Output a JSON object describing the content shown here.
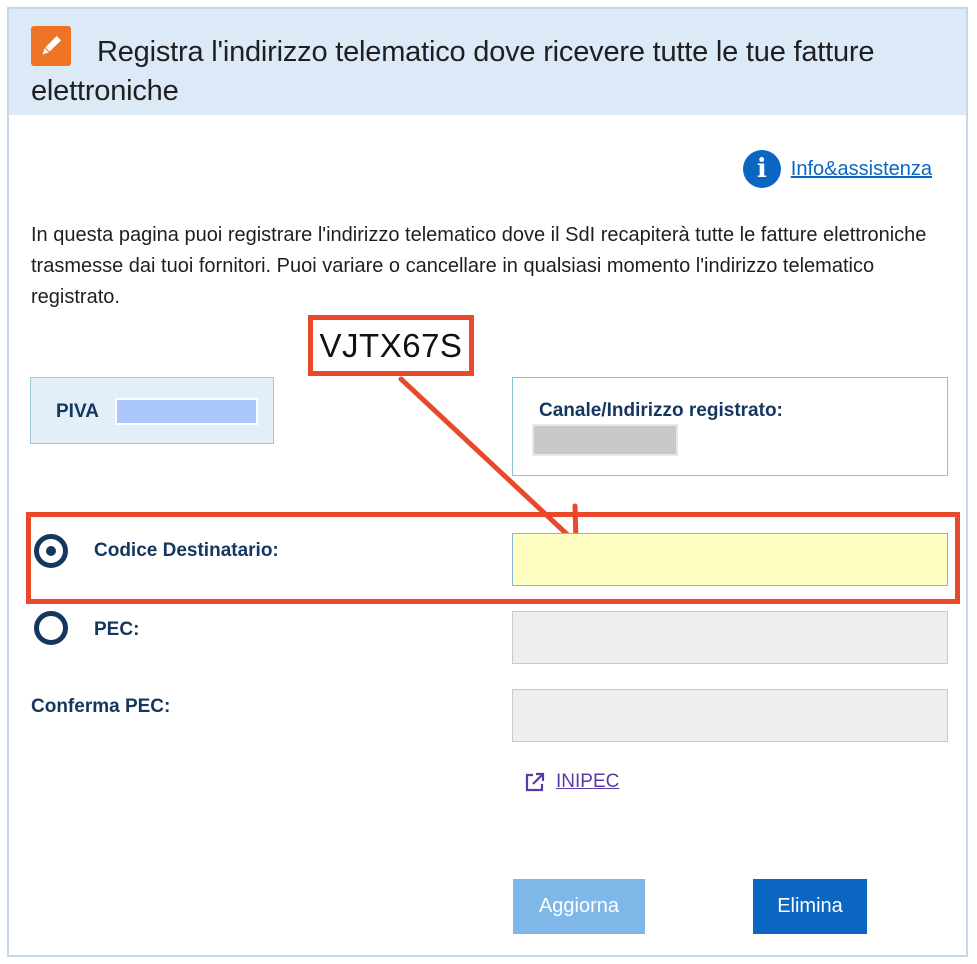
{
  "header": {
    "title": "Registra l'indirizzo telematico dove ricevere tutte le tue fatture elettroniche",
    "icon": "pencil-icon"
  },
  "info_link": {
    "label": "Info&assistenza",
    "icon": "info-icon"
  },
  "intro": "In questa pagina puoi registrare l'indirizzo telematico dove il SdI recapiterà tutte le fatture elettroniche trasmesse dai tuoi fornitori. Puoi variare o cancellare in qualsiasi momento l'indirizzo telematico registrato.",
  "annotation": {
    "code": "VJTX67S",
    "color": "#e8492a"
  },
  "piva": {
    "label": "PIVA"
  },
  "canale": {
    "label": "Canale/Indirizzo registrato:"
  },
  "form": {
    "codice_destinatario": {
      "label": "Codice Destinatario:",
      "selected": true,
      "value": ""
    },
    "pec": {
      "label": "PEC:",
      "selected": false,
      "value": ""
    },
    "conferma_pec": {
      "label": "Conferma PEC:",
      "value": ""
    }
  },
  "inipec": {
    "label": "INIPEC",
    "icon": "external-link-icon"
  },
  "buttons": {
    "aggiorna": "Aggiorna",
    "elimina": "Elimina"
  },
  "colors": {
    "header_bg": "#dce9f7",
    "accent_orange": "#ee7324",
    "primary_blue": "#0b66c2",
    "label_navy": "#15365e",
    "active_field": "#ffffc2"
  }
}
